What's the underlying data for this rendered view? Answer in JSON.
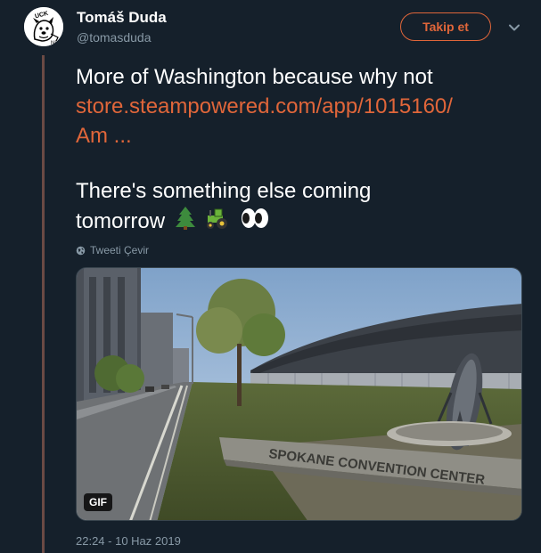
{
  "author": {
    "name": "Tomáš Duda",
    "handle": "@tomasduda",
    "avatar_icon": "dog-cartoon-avatar",
    "avatar_text": "UCK"
  },
  "actions": {
    "follow_label": "Takip et",
    "menu_icon": "chevron-down-icon"
  },
  "tweet": {
    "line1": "More of Washington because why not",
    "link_line1": "store.steampowered.com/app/1015160/",
    "link_line2": "Am ...",
    "line2": "There's something else coming",
    "line3_text": "tomorrow",
    "emojis": [
      "evergreen-tree-icon",
      "tractor-icon",
      "eyes-icon"
    ]
  },
  "translate": {
    "icon": "globe-icon",
    "label": "Tweeti Çevir"
  },
  "media": {
    "badge": "GIF",
    "sign_text": "SPOKANE CONVENTION CENTER"
  },
  "meta": {
    "timestamp": "22:24 - 10 Haz 2019"
  },
  "colors": {
    "background": "#15202b",
    "accent": "#e0663a",
    "muted": "#8899a6",
    "thread_line": "#6b4a44"
  }
}
